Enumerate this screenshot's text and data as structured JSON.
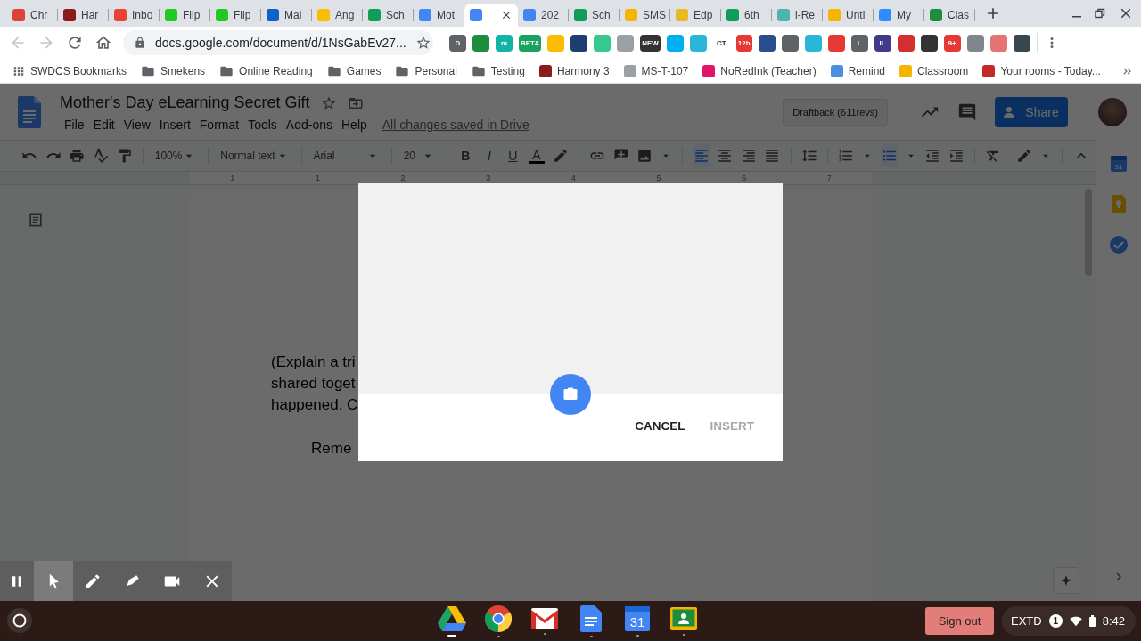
{
  "browser": {
    "tabs": [
      {
        "label": "Chr",
        "color": "#db4437",
        "selected": false
      },
      {
        "label": "Har",
        "color": "#8b1a1a",
        "selected": false
      },
      {
        "label": "Inbo",
        "color": "#ea4335",
        "selected": false
      },
      {
        "label": "Flip",
        "color": "#22c922",
        "selected": false
      },
      {
        "label": "Flip",
        "color": "#22c922",
        "selected": false
      },
      {
        "label": "Mai",
        "color": "#0a64c8",
        "selected": false
      },
      {
        "label": "Ang",
        "color": "#fbbc04",
        "selected": false
      },
      {
        "label": "Sch",
        "color": "#0f9d58",
        "selected": false
      },
      {
        "label": "Mot",
        "color": "#4285f4",
        "selected": false
      },
      {
        "color": "#4285f4",
        "selected": true
      },
      {
        "label": "202",
        "color": "#4285f4",
        "selected": false
      },
      {
        "label": "Sch",
        "color": "#0f9d58",
        "selected": false
      },
      {
        "label": "SMS",
        "color": "#f4b400",
        "selected": false
      },
      {
        "label": "Edp",
        "color": "#e8b923",
        "selected": false
      },
      {
        "label": "6th",
        "color": "#0f9d58",
        "selected": false
      },
      {
        "label": "i-Re",
        "color": "#4db6ac",
        "selected": false
      },
      {
        "label": "Unti",
        "color": "#f4b400",
        "selected": false
      },
      {
        "label": "My",
        "color": "#2d8cff",
        "selected": false
      },
      {
        "label": "Clas",
        "color": "#1e8e3e",
        "selected": false
      }
    ],
    "nav_buttons": [
      {
        "disabled": true
      },
      {
        "disabled": true
      }
    ],
    "address": "docs.google.com/document/d/1NsGabEv27...",
    "extensions": [
      {
        "label": "D",
        "color": "#5f6368"
      },
      {
        "color": "#1e8e3e"
      },
      {
        "label": "m",
        "color": "#12b5a5"
      },
      {
        "label": "BETA",
        "color": "#1aa260"
      },
      {
        "color": "#fbbc04"
      },
      {
        "color": "#1d3e6e"
      },
      {
        "color": "#34c98e"
      },
      {
        "color": "#9aa0a6"
      },
      {
        "label": "NEW",
        "color": "#333333"
      },
      {
        "color": "#00aff0"
      },
      {
        "color": "#29b6d8"
      },
      {
        "label": "CT",
        "color": "#ffffff"
      },
      {
        "label": "12h",
        "color": "#e53935"
      },
      {
        "color": "#2a4d8f"
      },
      {
        "color": "#5f6368"
      },
      {
        "color": "#29b6d8"
      },
      {
        "color": "#e53935"
      },
      {
        "label": "L",
        "color": "#5f6368"
      },
      {
        "label": "IL",
        "color": "#3f3a8c"
      },
      {
        "color": "#d32f2f"
      },
      {
        "color": "#333333"
      },
      {
        "label": "9+",
        "color": "#e53935"
      },
      {
        "color": "#80868b"
      },
      {
        "color": "#e57373"
      },
      {
        "color": "#37474f"
      }
    ],
    "bookmarks": [
      {
        "label": "SWDCS Bookmarks",
        "kind": "apps"
      },
      {
        "label": "Smekens",
        "kind": "folder"
      },
      {
        "label": "Online Reading",
        "kind": "folder"
      },
      {
        "label": "Games",
        "kind": "folder"
      },
      {
        "label": "Personal",
        "kind": "folder"
      },
      {
        "label": "Testing",
        "kind": "folder"
      },
      {
        "label": "Harmony 3",
        "kind": "site",
        "color": "#8b1a1a"
      },
      {
        "label": "MS-T-107",
        "kind": "site",
        "color": "#9aa0a6"
      },
      {
        "label": "NoRedInk (Teacher)",
        "kind": "site",
        "color": "#e0156b"
      },
      {
        "label": "Remind",
        "kind": "site",
        "color": "#4a90e2"
      },
      {
        "label": "Classroom",
        "kind": "site",
        "color": "#f4b400"
      },
      {
        "label": "Your rooms - Today...",
        "kind": "site",
        "color": "#c62828"
      }
    ]
  },
  "docs": {
    "title": "Mother's Day eLearning Secret Gift",
    "menus": [
      "File",
      "Edit",
      "View",
      "Insert",
      "Format",
      "Tools",
      "Add-ons",
      "Help"
    ],
    "save_status": "All changes saved in Drive",
    "draftback": "Draftback (611revs)",
    "share": "Share",
    "toolbar": {
      "zoom": "100%",
      "style": "Normal text",
      "font": "Arial",
      "size": "20",
      "bold": "B",
      "italic": "I",
      "underline": "U",
      "text_color": "A",
      "alignments": [
        {
          "selected": true
        },
        {
          "selected": false
        },
        {
          "selected": false
        },
        {
          "selected": false
        }
      ],
      "numbered_list": {
        "on": false
      },
      "bulleted_list": {
        "on": true
      }
    },
    "ruler": [
      "1",
      "1",
      "2",
      "3",
      "4",
      "5",
      "6",
      "7"
    ],
    "page_lines": [
      {
        "text": "(Explain a tri",
        "kind": "line"
      },
      {
        "text": "shared toget",
        "kind": "line"
      },
      {
        "text": "happened. C",
        "kind": "line"
      },
      {
        "text": "Reme",
        "kind": "indented"
      }
    ],
    "side_panel": {
      "calendar_day": "31"
    }
  },
  "dialog": {
    "buttons": [
      {
        "label": "CANCEL",
        "disabled": false
      },
      {
        "label": "INSERT",
        "disabled": true
      }
    ]
  },
  "capture_bar": {
    "tools": [
      {
        "selected": true
      },
      {
        "selected": false
      },
      {
        "selected": false
      }
    ]
  },
  "shelf": {
    "apps": [
      {
        "active": true
      },
      {
        "active": false
      },
      {
        "active": false
      },
      {
        "active": false
      },
      {
        "active": false,
        "label": "31"
      },
      {
        "active": false
      }
    ],
    "sign_out": "Sign out",
    "status": {
      "mode": "EXTD",
      "notifications": "1",
      "time": "8:42"
    }
  }
}
